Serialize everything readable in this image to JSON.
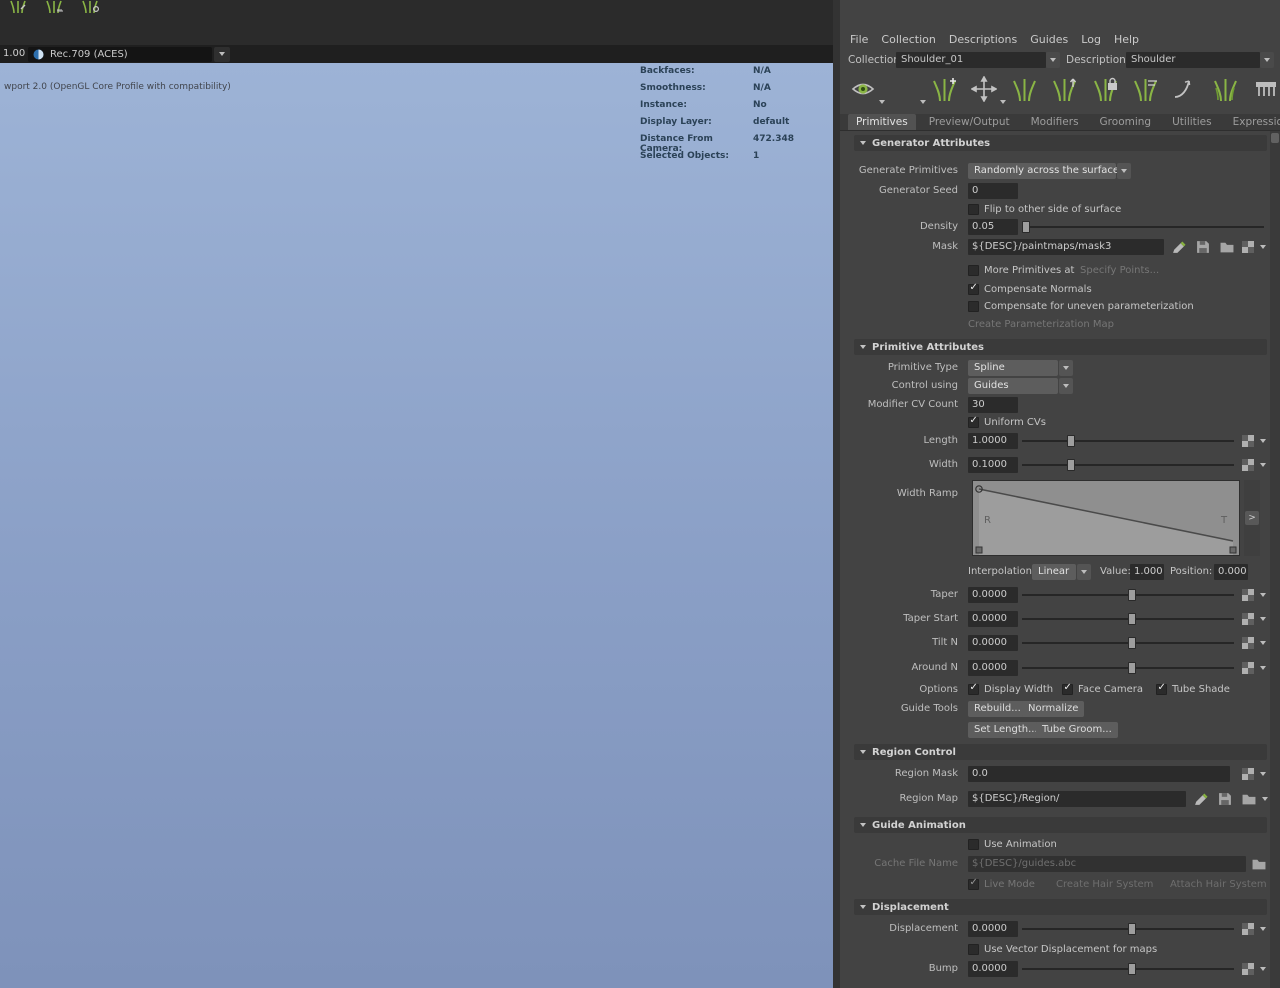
{
  "colors": {
    "viewport_top": "#9db3d6",
    "viewport_bottom": "#7e92ba",
    "panel_bg": "#434343",
    "field_bg": "#2b2b2b",
    "accent_green": "#8ab545"
  },
  "shelf": {
    "icons": [
      "grass-pencil-icon",
      "grass-comb-icon",
      "grass-place-icon"
    ]
  },
  "colorbar": {
    "exposure": "1.00",
    "colorspace": "Rec.709 (ACES)"
  },
  "viewport": {
    "renderer": "wport 2.0 (OpenGL Core Profile with compatibility)",
    "hud": [
      {
        "label": "Backfaces:",
        "value": "N/A"
      },
      {
        "label": "Smoothness:",
        "value": "N/A"
      },
      {
        "label": "Instance:",
        "value": "No"
      },
      {
        "label": "Display Layer:",
        "value": "default"
      },
      {
        "label": "Distance From Camera:",
        "value": "472.348"
      },
      {
        "label": "Selected Objects:",
        "value": "1"
      }
    ]
  },
  "panel": {
    "menus": [
      "File",
      "Collection",
      "Descriptions",
      "Guides",
      "Log",
      "Help"
    ],
    "collection": {
      "label": "Collection",
      "value": "Shoulder_01"
    },
    "description": {
      "label": "Description",
      "value": "Shoulder"
    },
    "toolbar_icons": [
      "eye-preview-icon",
      "preview-sphere-icon",
      "add-grass-icon",
      "place-primitives-icon",
      "sculpt-guides-icon",
      "guide-length-icon",
      "lock-guide-icon",
      "guide-normalize-icon",
      "convert-guides-icon",
      "density-grass-icon",
      "comb-icon"
    ],
    "tabs": [
      "Primitives",
      "Preview/Output",
      "Modifiers",
      "Grooming",
      "Utilities",
      "Expressions"
    ],
    "active_tab": "Primitives",
    "gen": {
      "title": "Generator Attributes",
      "generate": {
        "label": "Generate Primitives",
        "value": "Randomly across the surface"
      },
      "seed": {
        "label": "Generator Seed",
        "value": "0"
      },
      "flip": {
        "label": "Flip to other side of surface",
        "checked": false
      },
      "density": {
        "label": "Density",
        "value": "0.05",
        "slider": 0
      },
      "mask": {
        "label": "Mask",
        "value": "${DESC}/paintmaps/mask3"
      },
      "more_at": {
        "label": "More Primitives at",
        "checked": false,
        "action": "Specify Points..."
      },
      "comp_normals": {
        "label": "Compensate Normals",
        "checked": true
      },
      "comp_uneven": {
        "label": "Compensate for uneven parameterization",
        "checked": false
      },
      "create_param": {
        "label": "Create Parameterization Map"
      }
    },
    "prim": {
      "title": "Primitive Attributes",
      "type": {
        "label": "Primitive Type",
        "value": "Spline"
      },
      "control": {
        "label": "Control using",
        "value": "Guides"
      },
      "cv_count": {
        "label": "Modifier CV Count",
        "value": "30"
      },
      "uniform": {
        "label": "Uniform CVs",
        "checked": true
      },
      "length": {
        "label": "Length",
        "value": "1.0000",
        "slider": 21
      },
      "width": {
        "label": "Width",
        "value": "0.1000",
        "slider": 21
      },
      "ramp": {
        "label": "Width Ramp",
        "left_marker": "R",
        "right_marker": "T",
        "expand": ">"
      },
      "interp": {
        "label": "Interpolation:",
        "value": "Linear"
      },
      "ramp_value": {
        "label": "Value:",
        "value": "1.000"
      },
      "ramp_position": {
        "label": "Position:",
        "value": "0.000"
      },
      "taper": {
        "label": "Taper",
        "value": "0.0000",
        "slider": 50
      },
      "taper_start": {
        "label": "Taper Start",
        "value": "0.0000",
        "slider": 50
      },
      "tilt_n": {
        "label": "Tilt N",
        "value": "0.0000",
        "slider": 50
      },
      "around_n": {
        "label": "Around N",
        "value": "0.0000",
        "slider": 50
      },
      "options": {
        "label": "Options",
        "items": [
          {
            "label": "Display Width",
            "checked": true
          },
          {
            "label": "Face Camera",
            "checked": true
          },
          {
            "label": "Tube Shade",
            "checked": true
          }
        ]
      },
      "guide_tools": {
        "label": "Guide Tools",
        "buttons": [
          "Rebuild...",
          "Normalize",
          "Set Length...",
          "Tube Groom..."
        ]
      }
    },
    "region": {
      "title": "Region Control",
      "mask": {
        "label": "Region Mask",
        "value": "0.0"
      },
      "map": {
        "label": "Region Map",
        "value": "${DESC}/Region/"
      }
    },
    "anim": {
      "title": "Guide Animation",
      "use": {
        "label": "Use Animation",
        "checked": false
      },
      "cache": {
        "label": "Cache File Name",
        "value": "${DESC}/guides.abc"
      },
      "live": {
        "label": "Live Mode",
        "checked": true
      },
      "create_hair": "Create Hair System",
      "attach_hair": "Attach Hair System"
    },
    "disp": {
      "title": "Displacement",
      "displacement": {
        "label": "Displacement",
        "value": "0.0000",
        "slider": 50
      },
      "vector": {
        "label": "Use Vector Displacement for maps",
        "checked": false
      },
      "bump": {
        "label": "Bump",
        "value": "0.0000",
        "slider": 50
      }
    }
  }
}
